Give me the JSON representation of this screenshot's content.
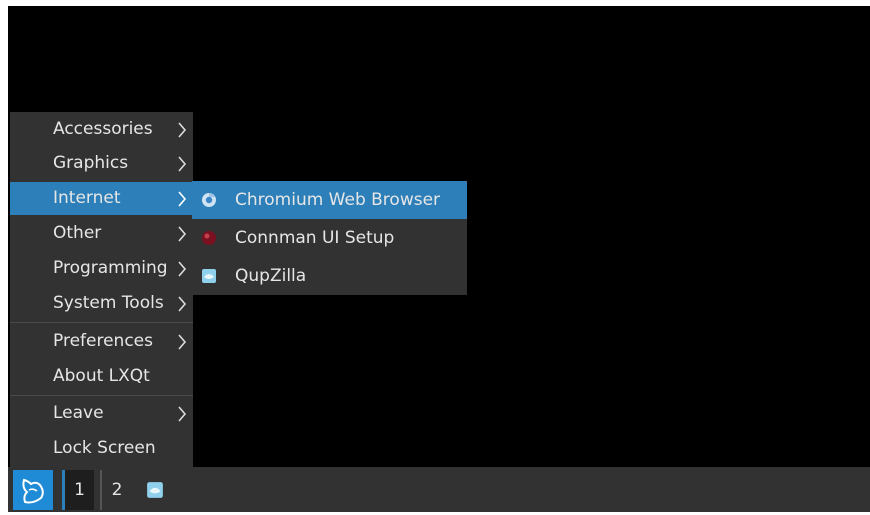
{
  "main_menu": {
    "items": [
      {
        "label": "Accessories",
        "has_submenu": true
      },
      {
        "label": "Graphics",
        "has_submenu": true
      },
      {
        "label": "Internet",
        "has_submenu": true,
        "active": true
      },
      {
        "label": "Other",
        "has_submenu": true
      },
      {
        "label": "Programming",
        "has_submenu": true
      },
      {
        "label": "System Tools",
        "has_submenu": true
      },
      {
        "label": "Preferences",
        "has_submenu": true
      },
      {
        "label": "About LXQt",
        "has_submenu": false
      },
      {
        "label": "Leave",
        "has_submenu": true
      },
      {
        "label": "Lock Screen",
        "has_submenu": false
      }
    ]
  },
  "submenu": {
    "items": [
      {
        "label": "Chromium Web Browser",
        "icon": "chromium-icon",
        "active": true
      },
      {
        "label": "Connman UI Setup",
        "icon": "connman-icon"
      },
      {
        "label": "QupZilla",
        "icon": "qupzilla-icon"
      }
    ]
  },
  "taskbar": {
    "desktops": [
      "1",
      "2"
    ],
    "active_desktop": "1"
  },
  "colors": {
    "highlight": "#2c7fb8",
    "menu_bg": "#323232",
    "desktop_bg": "#000000"
  }
}
